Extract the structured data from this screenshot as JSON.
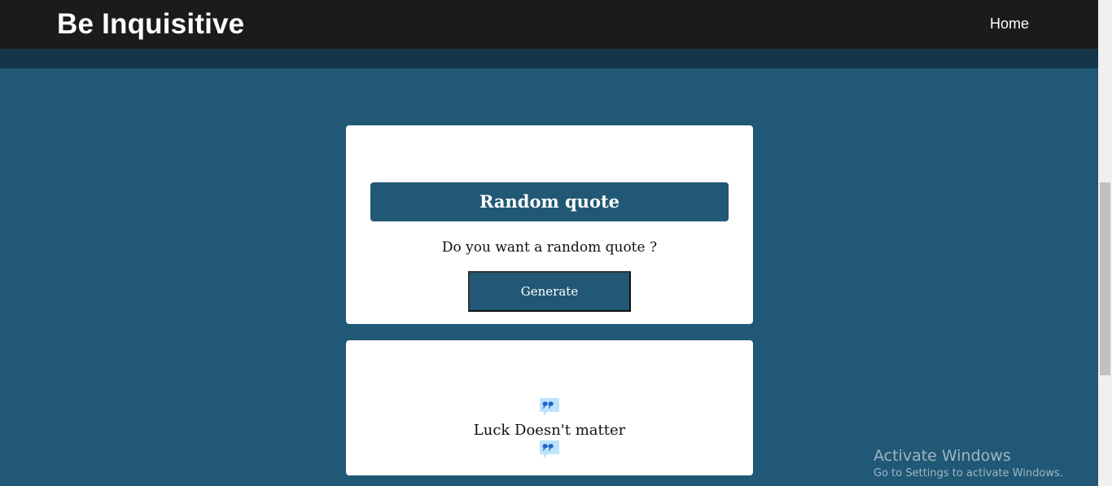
{
  "navbar": {
    "brand": "Be Inquisitive",
    "home_link": "Home"
  },
  "generator_card": {
    "title": "Random quote",
    "question": "Do you want a random quote ?",
    "generate_label": "Generate"
  },
  "quote_card": {
    "quote": "Luck Doesn't matter",
    "icon": "quote-icon"
  },
  "watermark": {
    "title": "Activate Windows",
    "subtitle": "Go to Settings to activate Windows."
  },
  "colors": {
    "page_background": "#205876",
    "navbar": "#1b1b1b",
    "subbar": "#15354a",
    "card": "#ffffff",
    "accent": "#205876",
    "quote_icon": "#bde3fb"
  }
}
